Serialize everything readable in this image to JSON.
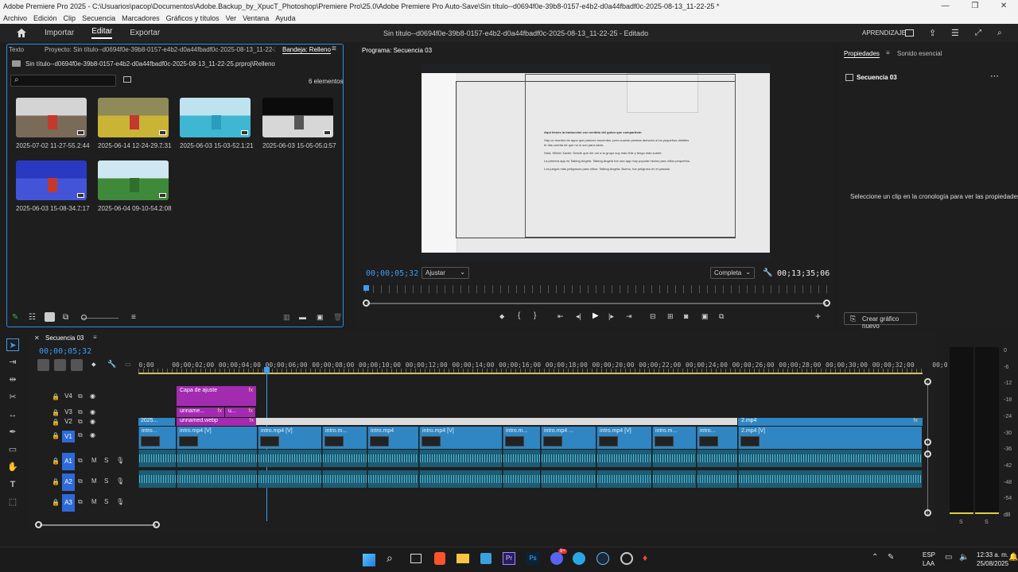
{
  "window": {
    "title": "Adobe Premiere Pro 2025 - C:\\Usuarios\\pacop\\Documentos\\Adobe.Backup_by_XpucT_Photoshop\\Premiere Pro\\25.0\\Adobe Premiere Pro Auto-Save\\Sin título--d0694f0e-39b8-0157-e4b2-d0a44fbadf0c-2025-08-13_11-22-25 *",
    "controls": [
      "—",
      "❐",
      "✕"
    ]
  },
  "menu": [
    "Archivo",
    "Edición",
    "Clip",
    "Secuencia",
    "Marcadores",
    "Gráficos y títulos",
    "Ver",
    "Ventana",
    "Ayuda"
  ],
  "header": {
    "tabs": [
      "Importar",
      "Editar",
      "Exportar"
    ],
    "active_tab": "Editar",
    "project_title": "Sin título--d0694f0e-39b8-0157-e4b2-d0a44fbadf0c-2025-08-13_11-22-25 - Editado",
    "learn_label": "APRENDIZAJE"
  },
  "project_panel": {
    "tabs": [
      "Texto",
      "Proyecto: Sin título--d0694f0e-39b8-0157-e4b2-d0a44fbadf0c-2025-08-13_11-22-25",
      "Bandeja: Relleno"
    ],
    "path": "Sin título--d0694f0e-39b8-0157-e4b2-d0a44fbadf0c-2025-08-13_11-22-25.prproj\\Relleno",
    "search_placeholder": "",
    "count": "6 elementos",
    "items": [
      {
        "name": "2025-07-02 11-27-55...",
        "duration": "2:44",
        "colors": [
          "#d4d4d4",
          "#7a6a58",
          "#c23a2a"
        ]
      },
      {
        "name": "2025-06-14 12-24-29...",
        "duration": "7:31",
        "colors": [
          "#8f8a58",
          "#c9b436",
          "#c33a2d"
        ]
      },
      {
        "name": "2025-06-03 15-03-52...",
        "duration": "1:21",
        "colors": [
          "#bfe3ee",
          "#3fb6d2",
          "#2a9cbc"
        ]
      },
      {
        "name": "2025-06-03 15-05-05...",
        "duration": "0:57",
        "colors": [
          "#0b0b0b",
          "#d7d7d7",
          "#555555"
        ]
      },
      {
        "name": "2025-06-03 15-08-34...",
        "duration": "7:17",
        "colors": [
          "#2a39c2",
          "#4454d8",
          "#c33a2d"
        ]
      },
      {
        "name": "2025-06-04 09-10-54...",
        "duration": "2:08",
        "colors": [
          "#cfe7f2",
          "#3f8a3a",
          "#2f6f2c"
        ]
      }
    ]
  },
  "program_monitor": {
    "title": "Programa: Secuencia 03",
    "timecode": "00;00;05;32",
    "fit": "Ajustar",
    "quality": "Completa",
    "duration": "00;13;35;06",
    "preview_lines": [
      "Aquí tienes la traducción con sentido del guion que compartiste:",
      "Hay un montón de apps que parecen inocentes, pero cuando prestas atención a los pequeños detalles te das cuenta de que no lo son para nada.",
      "Hola, Winter Xavier. Desde que me uní a tu grupo soy más feliz y tengo más suerte.",
      "La primera app es Talking Angela. Talking Angela fue una app muy popular hecha para niños pequeños.",
      "Los juegos más peligrosos para niños: Talking Angela. Bueno, fue peligroso en el pasado."
    ]
  },
  "properties": {
    "tabs": [
      "Propiedades",
      "Sonido esencial"
    ],
    "sequence": "Secuencia 03",
    "hint": "Seleccione un clip en la cronología para ver las propiedades.",
    "button": "Crear gráfico nuevo"
  },
  "timeline": {
    "tab": "Secuencia 03",
    "timecode": "00;00;05;32",
    "ruler": [
      "0;00",
      "00;00;02;00",
      "00;00;04;00",
      "00;00;06;00",
      "00;00;08;00",
      "00;00;10;00",
      "00;00;12;00",
      "00;00;14;00",
      "00;00;16;00",
      "00;00;18;00",
      "00;00;20;00",
      "00;00;22;00",
      "00;00;24;00",
      "00;00;26;00",
      "00;00;28;00",
      "00;00;30;00",
      "00;00;32;00",
      "00;0"
    ],
    "tracks_video": [
      "V4",
      "V3",
      "V2",
      "V1"
    ],
    "tracks_audio": [
      "A1",
      "A2",
      "A3"
    ],
    "track_m": "M",
    "track_s": "S",
    "adjust_clip": "Capa de ajuste",
    "fx": "fx",
    "v3_clips": [
      "unname...",
      "u..."
    ],
    "v2_clips": [
      "2025...",
      "unnamed.webp",
      "2.mp4"
    ],
    "v1_clips": [
      "intro...",
      "intro.mp4 [V]",
      "intro.mp4 [V]",
      "intro.m...",
      "intro.mp4",
      "intro.mp4 [V]",
      "intro.m...",
      "intro.mp4 ...",
      "intro.mp4 [V]",
      "intro.m...",
      "intro...",
      "2.mp4 [V]"
    ]
  },
  "meters": {
    "scale": [
      "0",
      "-6",
      "-12",
      "-18",
      "-24",
      "-30",
      "-36",
      "-42",
      "-48",
      "-54",
      "dB"
    ],
    "bottom": [
      "S",
      "S"
    ]
  },
  "taskbar": {
    "language": "ESP",
    "layout": "LAA",
    "time": "12:33 a. m.",
    "date": "25/08/2025",
    "badge": "9+"
  }
}
